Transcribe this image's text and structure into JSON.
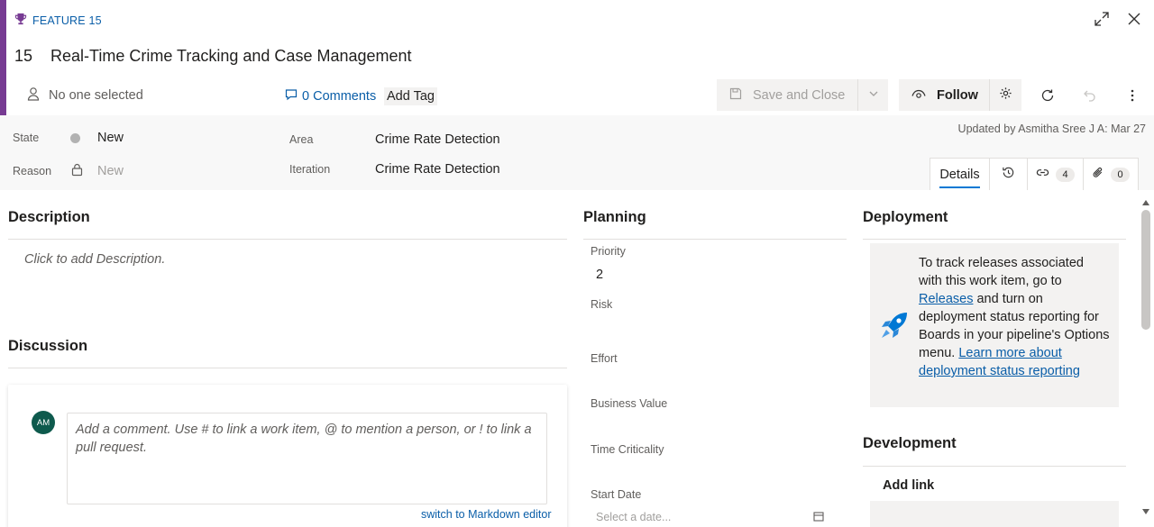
{
  "header": {
    "feature_label": "FEATURE 15",
    "item_id": "15",
    "title": "Real-Time Crime Tracking and Case Management",
    "assignee": "No one selected",
    "comments_label": "0 Comments",
    "add_tag_label": "Add Tag",
    "save_close_label": "Save and Close",
    "follow_label": "Follow"
  },
  "meta": {
    "state_label": "State",
    "state_value": "New",
    "reason_label": "Reason",
    "reason_value": "New",
    "area_label": "Area",
    "area_value": "Crime Rate Detection",
    "iteration_label": "Iteration",
    "iteration_value": "Crime Rate Detection",
    "updated_text": "Updated by Asmitha Sree J A: Mar 27"
  },
  "tabs": {
    "details_label": "Details",
    "links_count": "4",
    "attachments_count": "0"
  },
  "description": {
    "title": "Description",
    "placeholder": "Click to add Description."
  },
  "discussion": {
    "title": "Discussion",
    "avatar_initials": "AM",
    "comment_placeholder": "Add a comment. Use # to link a work item, @ to mention a person, or ! to link a pull request.",
    "markdown_link": "switch to Markdown editor"
  },
  "planning": {
    "title": "Planning",
    "priority_label": "Priority",
    "priority_value": "2",
    "risk_label": "Risk",
    "effort_label": "Effort",
    "business_value_label": "Business Value",
    "time_criticality_label": "Time Criticality",
    "start_date_label": "Start Date",
    "start_date_placeholder": "Select a date..."
  },
  "deployment": {
    "title": "Deployment",
    "text_1": "To track releases associated with this work item, go to ",
    "releases_link": "Releases",
    "text_2": " and turn on deployment status reporting for Boards in your pipeline's Options menu. ",
    "learn_more_link": "Learn more about deployment status reporting"
  },
  "development": {
    "title": "Development",
    "add_link_label": "Add link"
  },
  "colors": {
    "accent_purple": "#773b93",
    "link_blue": "#0a5ea8",
    "avatar_green": "#0e5a4d"
  }
}
